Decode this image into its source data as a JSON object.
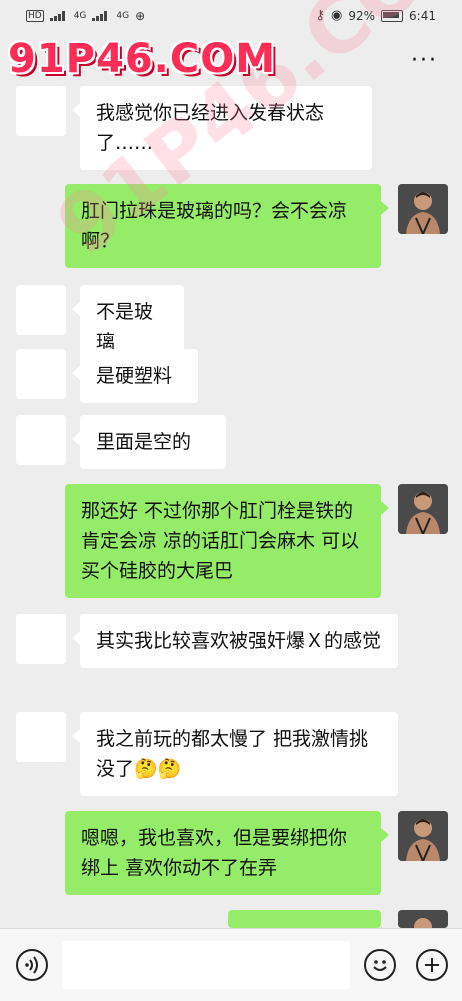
{
  "status": {
    "hd": "HD",
    "net1": "4G",
    "net2": "4G",
    "battery_pct": "92%",
    "time": "6:41"
  },
  "header": {
    "more": "···"
  },
  "watermark": {
    "text": "91P46.COM"
  },
  "messages": [
    {
      "side": "left",
      "text": "我感觉你已经进入发春状态了……"
    },
    {
      "side": "right",
      "text": "肛门拉珠是玻璃的吗？会不会凉啊？"
    },
    {
      "side": "left",
      "text": "不是玻璃"
    },
    {
      "side": "left",
      "text": "是硬塑料"
    },
    {
      "side": "left",
      "text": "里面是空的"
    },
    {
      "side": "right",
      "text": "那还好 不过你那个肛门栓是铁的 肯定会凉 凉的话肛门会麻木 可以买个硅胶的大尾巴"
    },
    {
      "side": "left",
      "text": "其实我比较喜欢被强奸爆Ｘ的感觉"
    },
    {
      "side": "left",
      "text": "我之前玩的都太慢了 把我激情挑没了🤔🤔"
    },
    {
      "side": "right",
      "text": "嗯嗯，我也喜欢，但是要绑把你绑上 喜欢你动不了在弄"
    },
    {
      "side": "right",
      "text": ""
    }
  ],
  "input": {
    "placeholder": ""
  },
  "icons": {
    "voice": "voice-icon",
    "emoji": "emoji-icon",
    "plus": "plus-icon"
  }
}
